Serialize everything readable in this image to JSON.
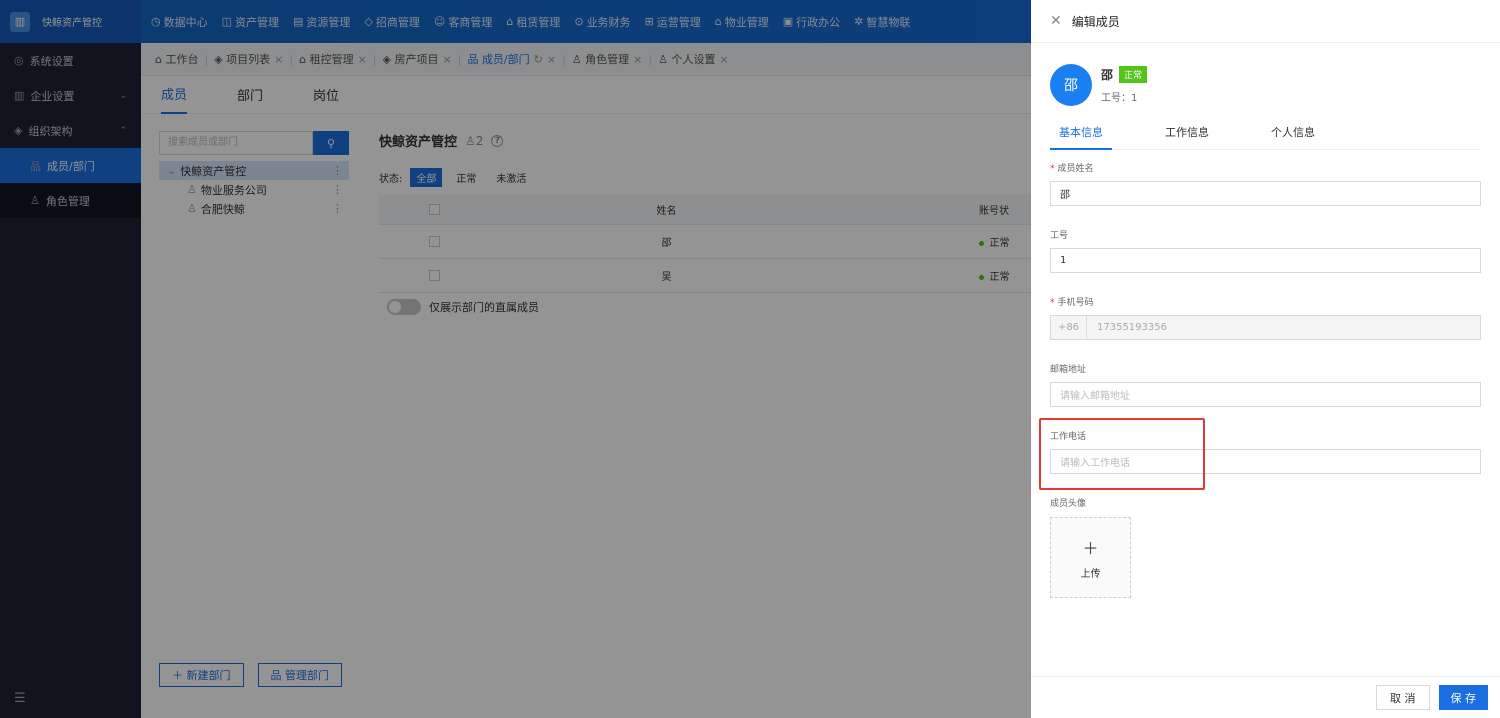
{
  "app": {
    "logo_text": "快鲸资产管控"
  },
  "topnav": [
    {
      "icon": "◷",
      "label": "数据中心"
    },
    {
      "icon": "◫",
      "label": "资产管理"
    },
    {
      "icon": "▤",
      "label": "资源管理"
    },
    {
      "icon": "◇",
      "label": "招商管理"
    },
    {
      "icon": "☺",
      "label": "客商管理"
    },
    {
      "icon": "⌂",
      "label": "租赁管理"
    },
    {
      "icon": "⊙",
      "label": "业务财务"
    },
    {
      "icon": "⊞",
      "label": "运营管理"
    },
    {
      "icon": "⌂",
      "label": "物业管理"
    },
    {
      "icon": "▣",
      "label": "行政办公"
    },
    {
      "icon": "✲",
      "label": "智慧物联"
    }
  ],
  "sidebar": {
    "items": [
      {
        "icon": "◎",
        "label": "系统设置"
      },
      {
        "icon": "▥",
        "label": "企业设置"
      },
      {
        "icon": "◈",
        "label": "组织架构"
      }
    ],
    "sub": [
      {
        "icon": "品",
        "label": "成员/部门"
      },
      {
        "icon": "♙",
        "label": "角色管理"
      }
    ],
    "bottom_icon": "☰"
  },
  "tabs": [
    {
      "label": "工作台"
    },
    {
      "label": "项目列表"
    },
    {
      "label": "租控管理"
    },
    {
      "label": "房产项目"
    },
    {
      "label": "成员/部门"
    },
    {
      "label": "角色管理"
    },
    {
      "label": "个人设置"
    }
  ],
  "subtabs": [
    "成员",
    "部门",
    "岗位"
  ],
  "left": {
    "search_placeholder": "搜索成员或部门",
    "tree": [
      "快鲸资产管控",
      "物业服务公司",
      "合肥快鲸"
    ],
    "btn_new": "新建部门",
    "btn_manage": "管理部门"
  },
  "content": {
    "title": "快鲸资产管控",
    "count": "2",
    "status_label": "状态:",
    "status_options": [
      "全部",
      "正常",
      "未激活"
    ],
    "col_name": "姓名",
    "col_status": "账号状",
    "rows": [
      {
        "name": "邵",
        "status": "正常"
      },
      {
        "name": "吴",
        "status": "正常"
      }
    ],
    "toggle_label": "仅展示部门的直属成员"
  },
  "drawer": {
    "title": "编辑成员",
    "avatar_char": "邵",
    "name": "邵",
    "badge": "正常",
    "job_no": "工号：1",
    "tabs": [
      "基本信息",
      "工作信息",
      "个人信息"
    ],
    "name_label": "成员姓名",
    "name_value": "邵",
    "jobno_label": "工号",
    "jobno_value": "1",
    "phone_label": "手机号码",
    "phone_prefix": "+86",
    "phone_value": "17355193356",
    "email_label": "邮箱地址",
    "email_placeholder": "请输入邮箱地址",
    "workphone_label": "工作电话",
    "workphone_placeholder": "请输入工作电话",
    "avatar_label": "成员头像",
    "upload_label": "上传",
    "cancel": "取 消",
    "save": "保 存"
  }
}
